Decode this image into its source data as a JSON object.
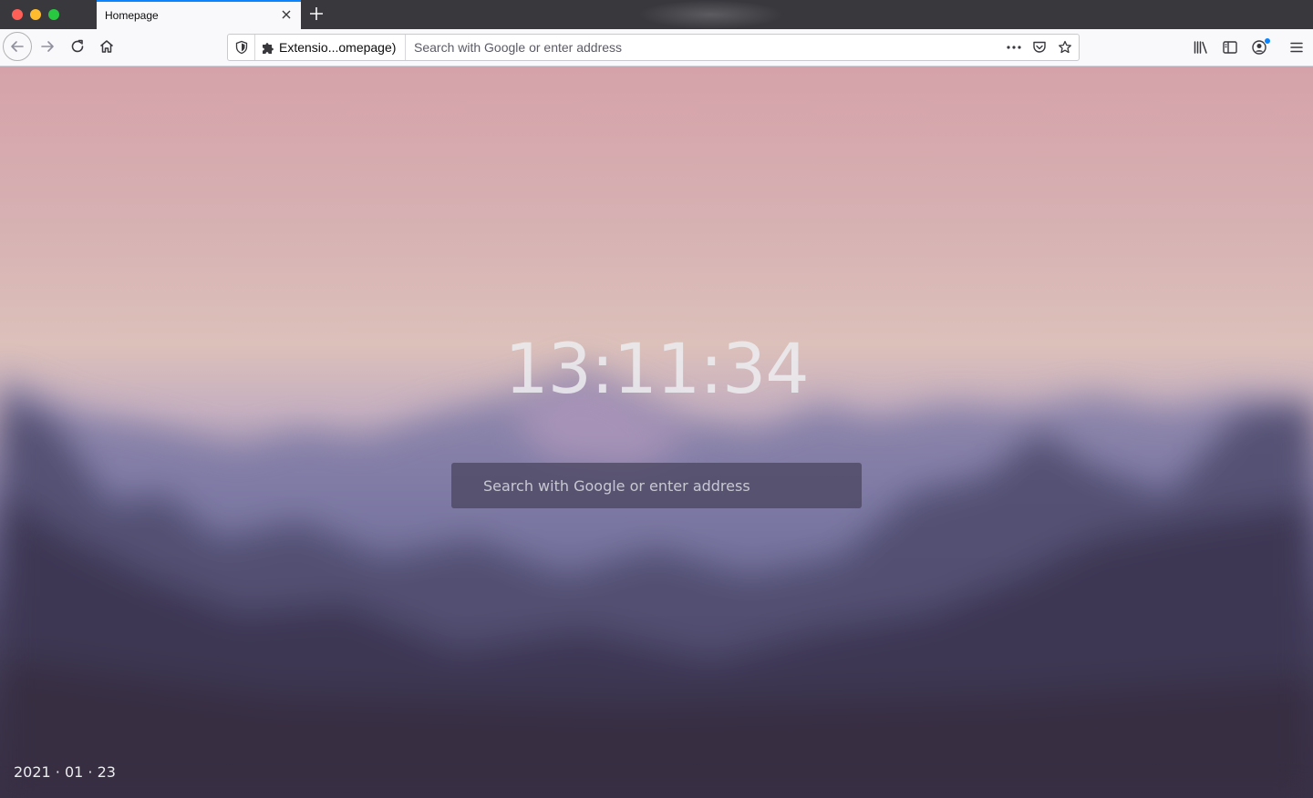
{
  "window": {
    "tab_title": "Homepage"
  },
  "navbar": {
    "identity_label": "Extensio...omepage)",
    "url_placeholder": "Search with Google or enter address"
  },
  "icons": {
    "back": "arrow-left-icon",
    "forward": "arrow-right-icon",
    "reload": "reload-icon",
    "home": "home-icon",
    "tracking": "shield-icon",
    "extension": "puzzle-icon",
    "page_actions": "more-horizontal-icon",
    "pocket": "pocket-icon",
    "bookmark": "star-icon",
    "library": "library-icon",
    "sidebar": "sidebar-icon",
    "account": "account-icon",
    "menu": "hamburger-icon"
  },
  "colors": {
    "tab_accent": "#0a84ff",
    "titlebar": "#38383d",
    "toolbar": "#f9f9fb"
  },
  "homepage": {
    "clock": "13:11:34",
    "search_placeholder": "Search with Google or enter address",
    "date": "2021 · 01 · 23"
  }
}
